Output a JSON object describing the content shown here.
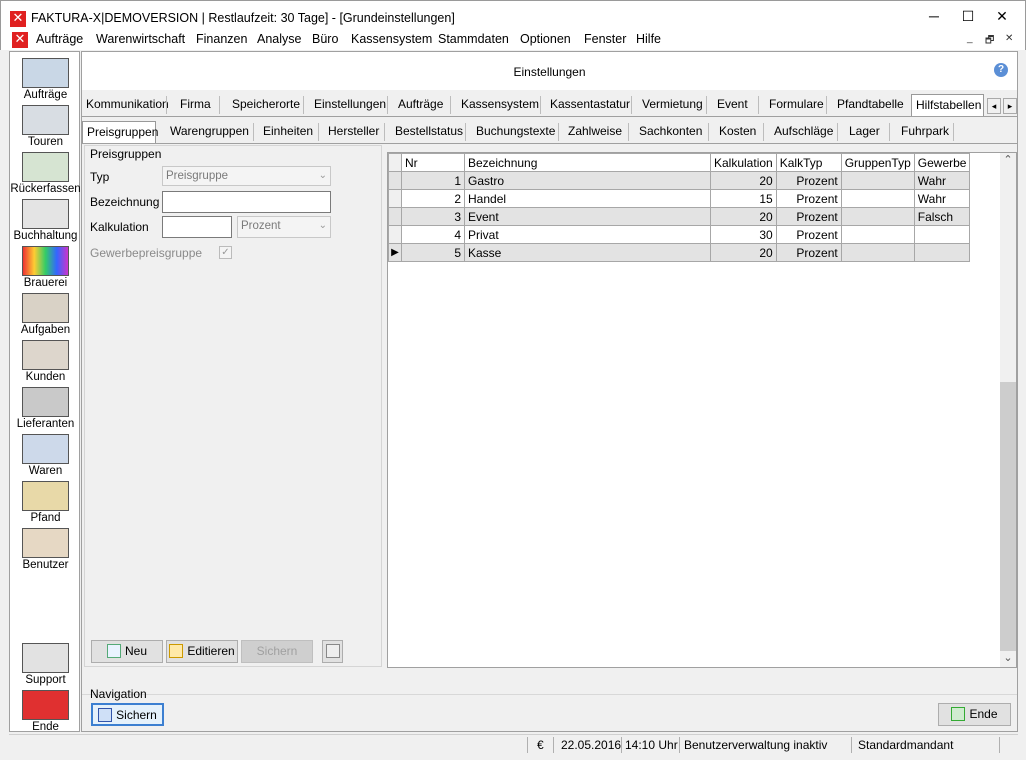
{
  "window": {
    "title": "FAKTURA-X|DEMOVERSION | Restlaufzeit: 30 Tage] - [Grundeinstellungen]",
    "logo_glyph": "✕",
    "minimize_glyph": "─",
    "maximize_glyph": "☐",
    "close_glyph": "✕"
  },
  "menu": {
    "items": [
      "Aufträge",
      "Warenwirtschaft",
      "Finanzen",
      "Analyse",
      "Büro",
      "Kassensystem",
      "Stammdaten",
      "Optionen",
      "Fenster",
      "Hilfe"
    ],
    "mdi_minimize": "_",
    "mdi_restore": "🗗",
    "mdi_close": "✕"
  },
  "sidebar": {
    "items": [
      {
        "label": "Aufträge",
        "icon": "headset-agent-icon"
      },
      {
        "label": "Touren",
        "icon": "truck-icon"
      },
      {
        "label": "Rückerfassen",
        "icon": "truck-check-icon"
      },
      {
        "label": "Buchhaltung",
        "icon": "ledger-icon"
      },
      {
        "label": "Brauerei",
        "icon": "color-wheel-icon"
      },
      {
        "label": "Aufgaben",
        "icon": "people-icon"
      },
      {
        "label": "Kunden",
        "icon": "customers-icon"
      },
      {
        "label": "Lieferanten",
        "icon": "warehouse-icon"
      },
      {
        "label": "Waren",
        "icon": "goods-icon"
      },
      {
        "label": "Pfand",
        "icon": "crate-icon"
      },
      {
        "label": "Benutzer",
        "icon": "user-lock-icon"
      }
    ],
    "support_label": "Support",
    "ende_label": "Ende"
  },
  "header": {
    "title": "Einstellungen",
    "help_glyph": "?"
  },
  "tabs": [
    "Kommunikation",
    "Firma",
    "Speicherorte",
    "Einstellungen",
    "Aufträge",
    "Kassensystem",
    "Kassentastatur",
    "Vermietung",
    "Event",
    "Formulare",
    "Pfandtabelle",
    "Hilfstabellen"
  ],
  "tab_scroll": {
    "left": "◂",
    "right": "▸"
  },
  "subtabs": [
    "Preisgruppen",
    "Warengruppen",
    "Einheiten",
    "Hersteller",
    "Bestellstatus",
    "Buchungstexte",
    "Zahlweise",
    "Sachkonten",
    "Kosten",
    "Aufschläge",
    "Lager",
    "Fuhrpark"
  ],
  "form": {
    "group_title": "Preisgruppen",
    "typ_label": "Typ",
    "typ_value": "Preisgruppe",
    "bezeichnung_label": "Bezeichnung",
    "bezeichnung_value": "",
    "kalkulation_label": "Kalkulation",
    "kalkulation_value": "",
    "kalk_typ_value": "Prozent",
    "gewerbe_label": "Gewerbepreisgruppe",
    "gewerbe_checked": true,
    "arrow_glyph": "⌄",
    "check_glyph": "✓"
  },
  "form_buttons": {
    "neu": "Neu",
    "editieren": "Editieren",
    "sichern": "Sichern"
  },
  "grid": {
    "columns": [
      "Nr",
      "Bezeichnung",
      "Kalkulation",
      "KalkTyp",
      "GruppenTyp",
      "Gewerbe"
    ],
    "rows": [
      {
        "nr": "1",
        "bez": "Gastro",
        "kalk": "20",
        "typ": "Prozent",
        "gtyp": "",
        "gew": "Wahr"
      },
      {
        "nr": "2",
        "bez": "Handel",
        "kalk": "15",
        "typ": "Prozent",
        "gtyp": "",
        "gew": "Wahr"
      },
      {
        "nr": "3",
        "bez": "Event",
        "kalk": "20",
        "typ": "Prozent",
        "gtyp": "",
        "gew": "Falsch"
      },
      {
        "nr": "4",
        "bez": "Privat",
        "kalk": "30",
        "typ": "Prozent",
        "gtyp": "",
        "gew": ""
      },
      {
        "nr": "5",
        "bez": "Kasse",
        "kalk": "20",
        "typ": "Prozent",
        "gtyp": "",
        "gew": ""
      }
    ],
    "current_row_glyph": "▶",
    "scroll_up": "⌃",
    "scroll_down": "⌄"
  },
  "navigation": {
    "label": "Navigation",
    "sichern": "Sichern",
    "ende": "Ende"
  },
  "status": {
    "currency": "€",
    "date": "22.05.2016",
    "time": "14:10 Uhr",
    "user_admin": "Benutzerverwaltung inaktiv",
    "mandant": "Standardmandant"
  }
}
